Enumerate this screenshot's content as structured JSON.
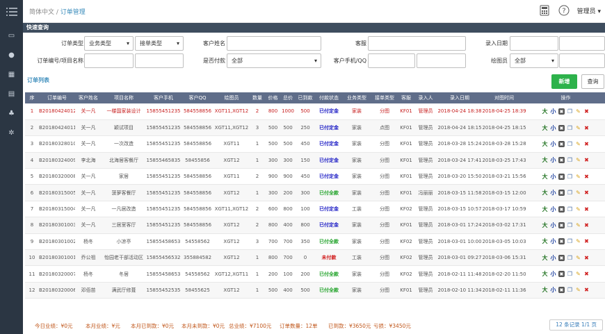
{
  "breadcrumb": {
    "root": "简体中文 /",
    "current": "订单管理"
  },
  "user": {
    "name": "管理员"
  },
  "section_title": "快速查询",
  "filters": {
    "order_type_label": "订单类型",
    "business_type": "业务类型",
    "receive_type": "接单类型",
    "customer_name_label": "客户姓名",
    "customer_label": "客服",
    "entry_date_label": "录入日期",
    "order_project_label": "订单编号/项目名称",
    "paid_label": "是否付款",
    "paid_value": "全部",
    "phone_label": "客户手机/QQ",
    "drafter_label": "绘图员",
    "drafter_value": "全部"
  },
  "list_title": "订单列表",
  "buttons": {
    "new": "新增",
    "query": "查询"
  },
  "table": {
    "headers": [
      "序",
      "订单编号",
      "客户姓名",
      "项目名称",
      "客户手机",
      "客户QQ",
      "绘图员",
      "数量",
      "价格",
      "总价",
      "已到款",
      "付款状态",
      "业务类型",
      "接单类型",
      "客服",
      "录入人",
      "录入日期",
      "对图时间",
      "操作"
    ],
    "rows": [
      [
        "1",
        "B20180424012",
        "关一凡",
        "一楼国家装设计",
        "15855451235",
        "584558856",
        "XGT11,XGT12",
        "2",
        "800",
        "1000",
        "500",
        "已付定金",
        "家装",
        "分图",
        "KF01",
        "管理员",
        "2018-04-24 18:38",
        "2018-04-25 18:39"
      ],
      [
        "2",
        "B20180424011",
        "关一凡",
        "颖试项目",
        "15855451235",
        "584558856",
        "XGT11,XGT12",
        "3",
        "500",
        "500",
        "250",
        "已付定金",
        "家装",
        "点图",
        "KF01",
        "管理员",
        "2018-04-24 18:15",
        "2018-04-25 18:15"
      ],
      [
        "3",
        "B20180328010",
        "关一凡",
        "一次改造",
        "15855451235",
        "584558856",
        "XGT11",
        "1",
        "500",
        "500",
        "450",
        "已付定金",
        "家装",
        "分图",
        "KF01",
        "管理员",
        "2018-03-28 15:24",
        "2018-03-28 15:28"
      ],
      [
        "4",
        "B20180324009",
        "李北海",
        "北海居客餐厅",
        "15855465835",
        "58455856",
        "XGT12",
        "1",
        "300",
        "300",
        "150",
        "已付定金",
        "家装",
        "分图",
        "KF01",
        "管理员",
        "2018-03-24 17:41",
        "2018-03-25 17:43"
      ],
      [
        "5",
        "B20180320008",
        "关一凡",
        "家居",
        "15855451235",
        "584558856",
        "XGT11",
        "2",
        "900",
        "900",
        "450",
        "已付定金",
        "家装",
        "分图",
        "KF01",
        "管理员",
        "2018-03-20 15:50",
        "2018-03-21 15:56"
      ],
      [
        "6",
        "B20180315005",
        "关一凡",
        "菠萝客餐厅",
        "15855451235",
        "584558856",
        "XGT12",
        "1",
        "300",
        "200",
        "300",
        "已付全款",
        "家装",
        "分图",
        "KF01",
        "冯丽丽",
        "2018-03-15 11:58",
        "2018-03-15 12:00"
      ],
      [
        "7",
        "B20180315004",
        "关一凡",
        "一凡居改造",
        "15855451235",
        "584558856",
        "XGT11,XGT12",
        "2",
        "600",
        "800",
        "100",
        "已付定金",
        "工装",
        "分图",
        "KF02",
        "管理员",
        "2018-03-15 10:57",
        "2018-03-17 10:59"
      ],
      [
        "8",
        "B20180301003",
        "关一凡",
        "三居室客厅",
        "15855451235",
        "584558856",
        "XGT12",
        "2",
        "800",
        "400",
        "800",
        "已付定金",
        "家装",
        "分图",
        "KF01",
        "管理员",
        "2018-03-01 17:24",
        "2018-03-02 17:31"
      ],
      [
        "9",
        "B20180301002",
        "杨冬",
        "小凉亭",
        "15855458653",
        "54558562",
        "XGT12",
        "3",
        "700",
        "700",
        "350",
        "已付全款",
        "家装",
        "分图",
        "KF02",
        "管理员",
        "2018-03-01 10:00",
        "2018-03-05 10:03"
      ],
      [
        "10",
        "B20180301001",
        "乔公祖",
        "怡园老干部活动区",
        "15855456532",
        "355884582",
        "XGT12",
        "1",
        "800",
        "700",
        "0",
        "未付款",
        "工装",
        "分图",
        "KF02",
        "管理员",
        "2018-03-01 09:27",
        "2018-03-06 15:31"
      ],
      [
        "11",
        "B20180320007",
        "杨冬",
        "冬居",
        "15855458653",
        "54558562",
        "XGT12,XGT11",
        "1",
        "200",
        "100",
        "200",
        "已付全款",
        "家装",
        "分图",
        "KF02",
        "管理员",
        "2018-02-11 11:48",
        "2018-02-20 11:50"
      ],
      [
        "12",
        "B20180320006",
        "邓佰苗",
        "满武厅修葺",
        "15855452535",
        "58455625",
        "XGT12",
        "1",
        "500",
        "400",
        "500",
        "已付全款",
        "家装",
        "分图",
        "KF01",
        "管理员",
        "2018-02-10 11:34",
        "2018-02-11 11:36"
      ]
    ]
  },
  "footer": {
    "today": "今日业绩：¥0元",
    "month": "本月业绩：¥元",
    "month_paid": "本月已到款：¥0元",
    "month_unpaid": "本月未到款：¥0元",
    "total": "总业绩：¥7100元",
    "order_count": "订单数量：12单",
    "paid": "已到款：¥3650元",
    "owed": "亏损：¥3450元",
    "pager": "12 条记录 1/1 页"
  },
  "colors": {
    "sidebar": "#2b3643",
    "header": "#5f6d89",
    "new_button": "#2db24b",
    "accent": "#3c8dbc"
  }
}
